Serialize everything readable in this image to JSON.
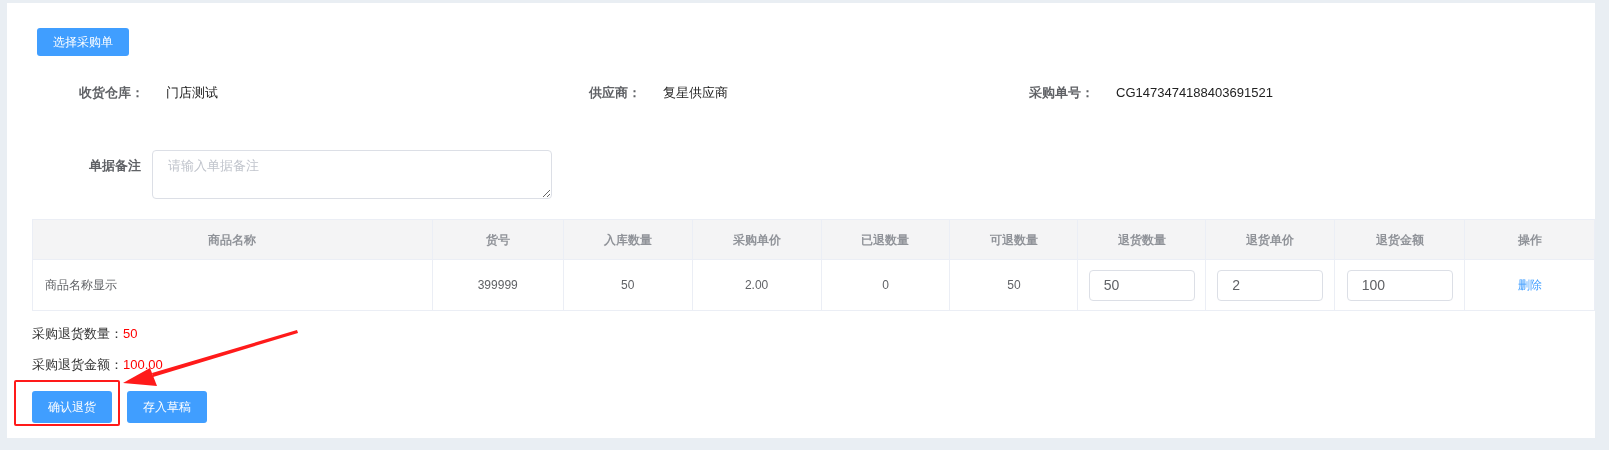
{
  "select_button": "选择采购单",
  "info": [
    {
      "label": "收货仓库：",
      "value": "门店测试"
    },
    {
      "label": "供应商：",
      "value": "复星供应商"
    },
    {
      "label": "采购单号：",
      "value": "CG1473474188403691521"
    }
  ],
  "remark": {
    "label": "单据备注",
    "placeholder": "请输入单据备注"
  },
  "table": {
    "columns": [
      "商品名称",
      "货号",
      "入库数量",
      "采购单价",
      "已退数量",
      "可退数量",
      "退货数量",
      "退货单价",
      "退货金额",
      "操作"
    ],
    "rows": [
      [
        {
          "kind": "text",
          "text": "商品名称显示"
        },
        {
          "kind": "text",
          "text": "399999"
        },
        {
          "kind": "text",
          "text": "50"
        },
        {
          "kind": "text",
          "text": "2.00"
        },
        {
          "kind": "text",
          "text": "0"
        },
        {
          "kind": "text",
          "text": "50"
        },
        {
          "kind": "input",
          "text": "50"
        },
        {
          "kind": "input",
          "text": "2"
        },
        {
          "kind": "input",
          "text": "100"
        },
        {
          "kind": "link",
          "text": "删除"
        }
      ]
    ]
  },
  "summary": [
    {
      "label": "采购退货数量：",
      "value": "50"
    },
    {
      "label": "采购退货金额：",
      "value": "100.00"
    }
  ],
  "buttons": [
    {
      "label": "确认退货",
      "highlighted": true
    },
    {
      "label": "存入草稿",
      "highlighted": false
    }
  ]
}
